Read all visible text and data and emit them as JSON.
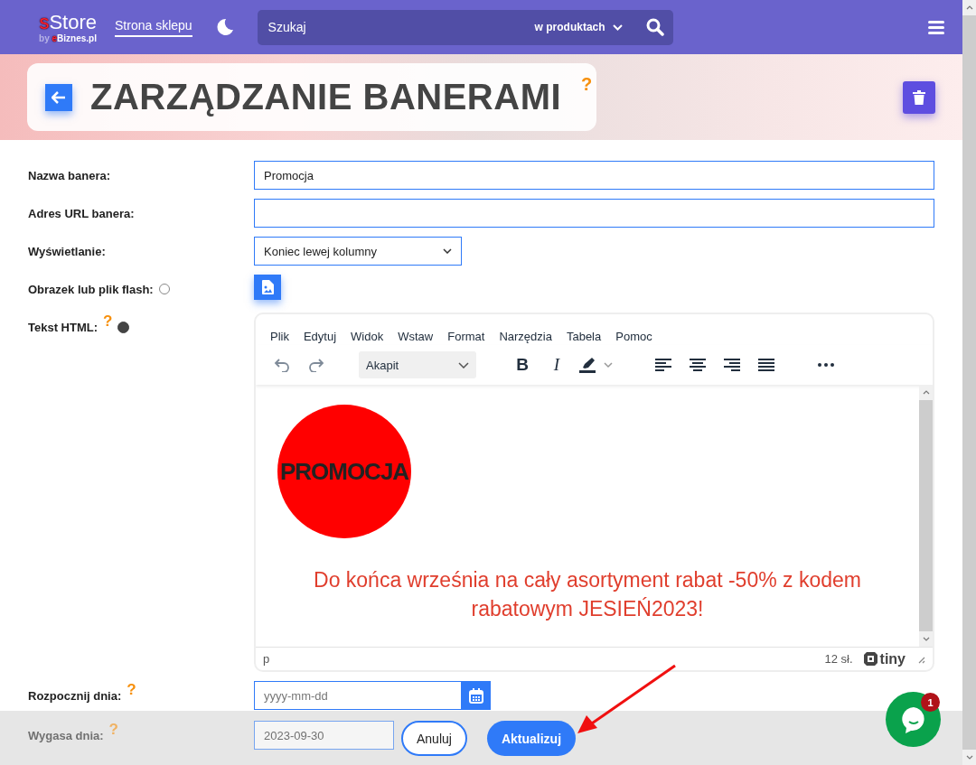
{
  "header": {
    "logo": {
      "initial": "s",
      "name": "Store",
      "by": "by",
      "brand_initial": "e",
      "brand": "Biznes.pl"
    },
    "shop_link": "Strona sklepu",
    "search": {
      "placeholder": "Szukaj",
      "scope": "w produktach"
    }
  },
  "banner": {
    "title": "ZARZĄDZANIE BANERAMI",
    "help": "?"
  },
  "fields": [
    {
      "kind": "text",
      "label": "Nazwa banera:",
      "value": "Promocja"
    },
    {
      "kind": "text",
      "label": "Adres URL banera:"
    },
    {
      "kind": "select",
      "label": "Wyświetlanie:",
      "value": "Koniec lewej kolumny"
    },
    {
      "kind": "file",
      "label": "Obrazek lub plik flash:",
      "selected": false
    },
    {
      "kind": "editor",
      "label": "Tekst HTML:",
      "help": "?",
      "selected": true
    },
    {
      "kind": "date",
      "label": "Rozpocznij dnia:",
      "help": "?",
      "placeholder": "yyyy-mm-dd"
    }
  ],
  "editor": {
    "menu": [
      "Plik",
      "Edytuj",
      "Widok",
      "Wstaw",
      "Format",
      "Narzędzia",
      "Tabela",
      "Pomoc"
    ],
    "format": "Akapit",
    "bold_glyph": "B",
    "italic_glyph": "I",
    "badge": "PROMOCJA",
    "paragraph": "Do końca września na cały asortyment rabat -50% z kodem rabatowym JESIEŃ2023!",
    "path": "p",
    "word_count": "12 sł.",
    "brand": "tiny"
  },
  "footer": {
    "faded_row": {
      "label": "Wygasa dnia:",
      "help": "?",
      "value": "2023-09-30"
    },
    "buttons": [
      {
        "label": "Anuluj",
        "kind": "secondary"
      },
      {
        "label": "Aktualizuj",
        "kind": "primary"
      }
    ]
  },
  "chat": {
    "badge": "1"
  }
}
